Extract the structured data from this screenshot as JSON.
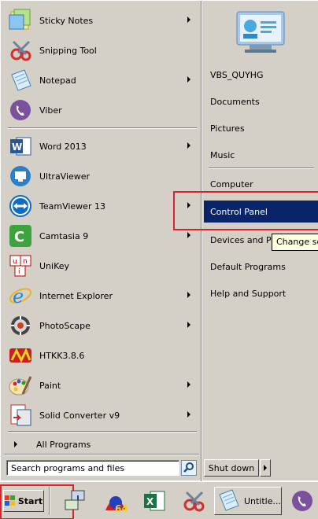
{
  "programs": [
    {
      "label": "Sticky Notes",
      "has_arrow": true,
      "icon": "sticky-notes-icon"
    },
    {
      "label": "Snipping Tool",
      "has_arrow": false,
      "icon": "scissors-icon"
    },
    {
      "label": "Notepad",
      "has_arrow": true,
      "icon": "notepad-icon"
    },
    {
      "label": "Viber",
      "has_arrow": false,
      "icon": "viber-icon"
    },
    {
      "label": "Word 2013",
      "has_arrow": true,
      "icon": "word-icon"
    },
    {
      "label": "UltraViewer",
      "has_arrow": false,
      "icon": "ultraviewer-icon"
    },
    {
      "label": "TeamViewer 13",
      "has_arrow": true,
      "icon": "teamviewer-icon"
    },
    {
      "label": "Camtasia 9",
      "has_arrow": true,
      "icon": "camtasia-icon"
    },
    {
      "label": "UniKey",
      "has_arrow": false,
      "icon": "unikey-icon"
    },
    {
      "label": "Internet Explorer",
      "has_arrow": true,
      "icon": "internet-explorer-icon"
    },
    {
      "label": "PhotoScape",
      "has_arrow": true,
      "icon": "photoscape-icon"
    },
    {
      "label": "HTKK3.8.6",
      "has_arrow": false,
      "icon": "htkk-icon"
    },
    {
      "label": "Paint",
      "has_arrow": true,
      "icon": "paint-icon"
    },
    {
      "label": "Solid Converter v9",
      "has_arrow": true,
      "icon": "solid-converter-icon"
    }
  ],
  "all_programs": "All Programs",
  "search": {
    "placeholder": "Search programs and files",
    "value": "Search programs and files"
  },
  "right_items": [
    {
      "label": "VBS_QUYHG",
      "selected": false
    },
    {
      "label": "Documents",
      "selected": false
    },
    {
      "label": "Pictures",
      "selected": false
    },
    {
      "label": "Music",
      "selected": false
    },
    {
      "label": "Computer",
      "selected": false
    },
    {
      "label": "Control Panel",
      "selected": true
    },
    {
      "label": "Devices and Printers",
      "selected": false
    },
    {
      "label": "Default Programs",
      "selected": false
    },
    {
      "label": "Help and Support",
      "selected": false
    }
  ],
  "tooltip": "Change settings",
  "shutdown_label": "Shut down",
  "taskbar": {
    "start_label": "Start",
    "task_label": "Untitle..."
  },
  "colors": {
    "highlight": "#0a246a",
    "annotation_red": "#e0202a",
    "tooltip_bg": "#ffffe1"
  }
}
